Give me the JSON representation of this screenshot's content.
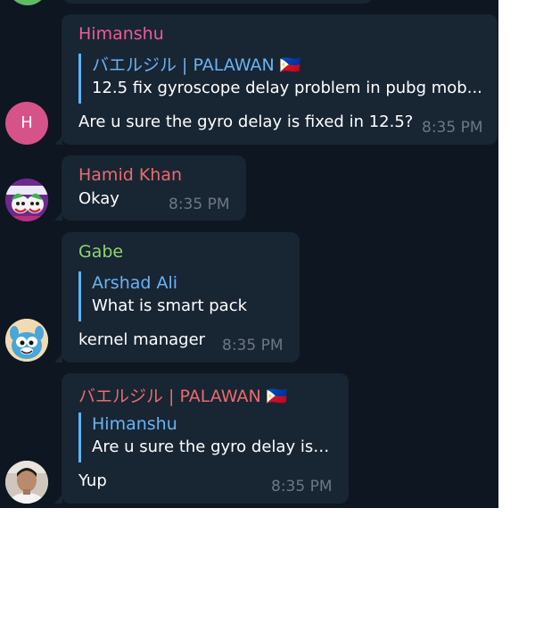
{
  "messages": [
    {
      "sender": "Himanshu",
      "sender_color": "#ee5b97",
      "quote": {
        "name": "バエルジル | PALAWAN 🇵🇭",
        "text": "12.5 fix gyroscope delay  problem in pubg mob..."
      },
      "text": "Are u sure the gyro delay is fixed in 12.5?",
      "time": "8:35 PM",
      "avatar": {
        "letter": "H",
        "color": "#d65389"
      }
    },
    {
      "sender": "Hamid Khan",
      "sender_color": "#ec6b6a",
      "text": "Okay",
      "time": "8:35 PM",
      "avatar": {
        "icon": "joker-avatar"
      }
    },
    {
      "sender": "Gabe",
      "sender_color": "#8dd56d",
      "quote": {
        "name": "Arshad Ali",
        "text": "What is smart pack"
      },
      "text": "kernel manager",
      "time": "8:35 PM",
      "avatar": {
        "icon": "gumball-avatar"
      }
    },
    {
      "sender": "バエルジル | PALAWAN 🇵🇭",
      "sender_color": "#ec6b6a",
      "quote": {
        "name": "Himanshu",
        "text": "Are u sure the gyro delay is ..."
      },
      "text": "Yup",
      "time": "8:35 PM",
      "avatar": {
        "icon": "user-photo-avatar"
      }
    }
  ]
}
